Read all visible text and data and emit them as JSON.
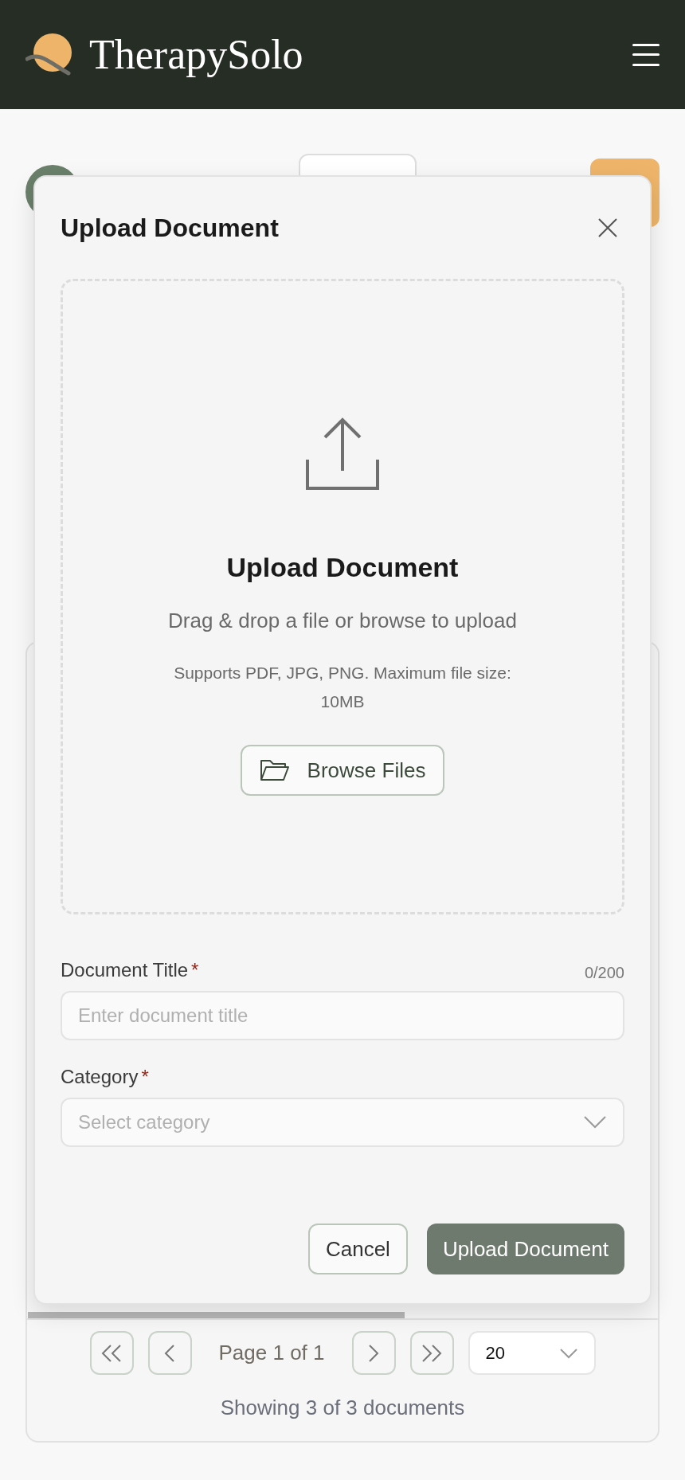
{
  "header": {
    "brand": "TherapySolo"
  },
  "modal": {
    "title": "Upload Document",
    "dropzone": {
      "heading": "Upload Document",
      "subtext": "Drag & drop a file or browse to upload",
      "note": "Supports PDF, JPG, PNG. Maximum file size: 10MB",
      "browse_button": "Browse Files"
    },
    "fields": [
      {
        "kind": "text",
        "label": "Document Title",
        "required_mark": "*",
        "counter": "0/200",
        "placeholder": "Enter document title"
      },
      {
        "kind": "select",
        "label": "Category",
        "required_mark": "*",
        "placeholder": "Select category"
      }
    ],
    "buttons": [
      {
        "kind": "secondary",
        "label": "Cancel"
      },
      {
        "kind": "primary",
        "label": "Upload Document"
      }
    ]
  },
  "pagination": {
    "page_label": "Page 1 of 1",
    "page_size": "20",
    "summary": "Showing 3 of 3 documents"
  }
}
